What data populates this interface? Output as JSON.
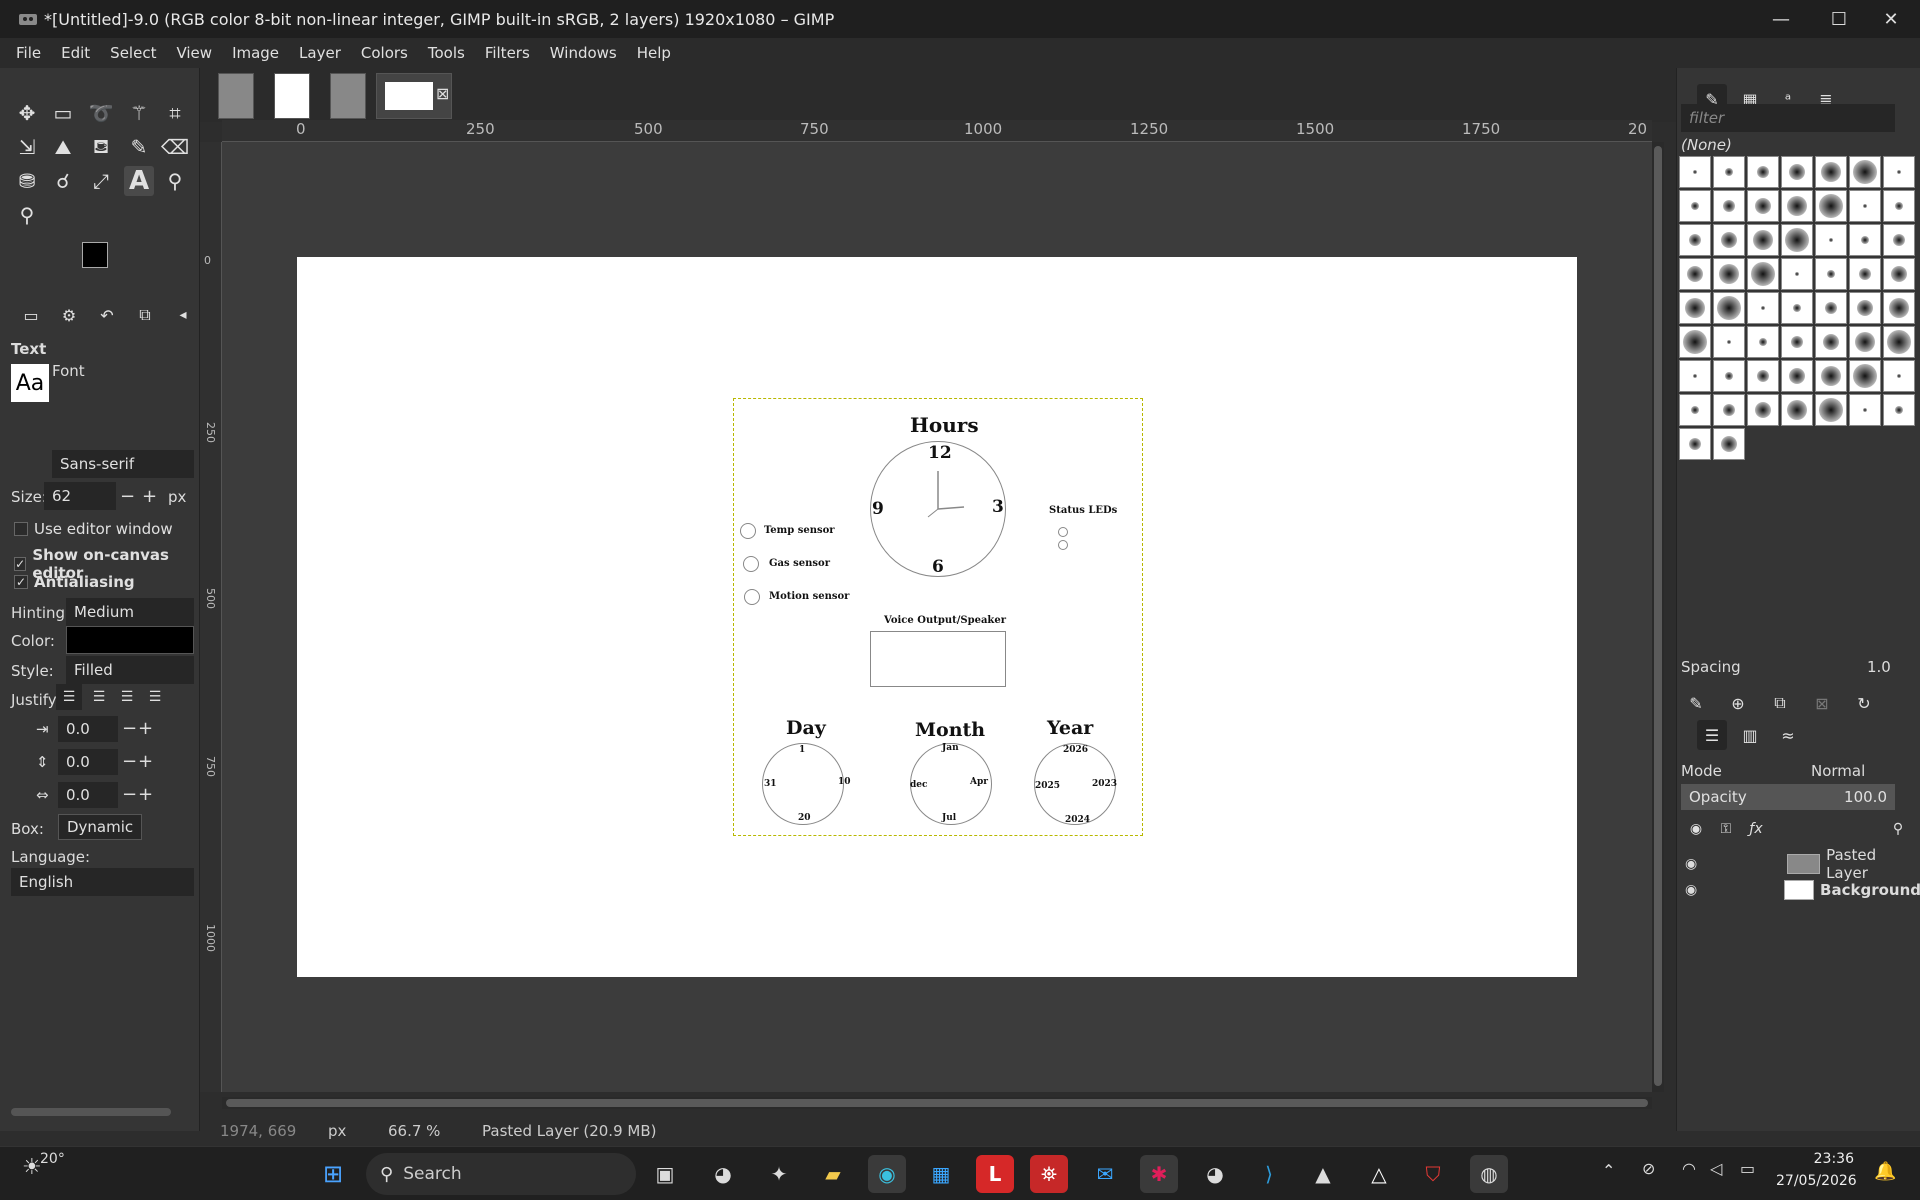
{
  "window": {
    "title": "*[Untitled]-9.0 (RGB color 8-bit non-linear integer, GIMP built-in sRGB, 2 layers) 1920x1080 – GIMP",
    "minimize": "—",
    "maximize": "☐",
    "close": "✕"
  },
  "menu": [
    "File",
    "Edit",
    "Select",
    "View",
    "Image",
    "Layer",
    "Colors",
    "Tools",
    "Filters",
    "Windows",
    "Help"
  ],
  "tool_options": {
    "section_title": "Text",
    "font_label": "Font",
    "font_preview": "Aa",
    "font_value": "Sans-serif",
    "size_label": "Size:",
    "size_value": "62",
    "size_unit": "px",
    "use_editor_window": "Use editor window",
    "show_on_canvas_editor": "Show on-canvas editor",
    "antialiasing": "Antialiasing",
    "hinting_label": "Hinting:",
    "hinting_value": "Medium",
    "color_label": "Color:",
    "style_label": "Style:",
    "style_value": "Filled",
    "justify_label": "Justify:",
    "indent_value": "0.0",
    "line_spacing_value": "0.0",
    "letter_spacing_value": "0.0",
    "box_label": "Box:",
    "box_value": "Dynamic",
    "language_label": "Language:",
    "language_value": "English"
  },
  "ruler": {
    "h_labels": [
      "0",
      "250",
      "500",
      "750",
      "1000",
      "1250",
      "1500",
      "1750",
      "20"
    ],
    "v_labels": [
      "0",
      "250",
      "500",
      "750",
      "1000"
    ]
  },
  "diagram": {
    "hours_title": "Hours",
    "clock_numbers": [
      "12",
      "3",
      "6",
      "9"
    ],
    "sensors": [
      "Temp sensor",
      "Gas sensor",
      "Motion sensor"
    ],
    "status_leds": "Status LEDs",
    "voice_output": "Voice Output/Speaker",
    "day_title": "Day",
    "day_numbers": [
      "1",
      "10",
      "20",
      "31"
    ],
    "month_title": "Month",
    "month_labels": [
      "Jan",
      "Apr",
      "Jul",
      "dec"
    ],
    "year_title": "Year",
    "year_labels": [
      "2026",
      "2023",
      "2024",
      "2025"
    ]
  },
  "statusbar": {
    "coords": "1974, 669",
    "unit": "px",
    "zoom": "66.7 %",
    "info": "Pasted Layer (20.9 MB)"
  },
  "dock": {
    "filter_placeholder": "filter",
    "brush_selected": "(None)",
    "spacing_label": "Spacing",
    "spacing_value": "1.0",
    "mode_label": "Mode",
    "mode_value": "Normal",
    "opacity_label": "Opacity",
    "opacity_value": "100.0",
    "layers": [
      {
        "name": "Pasted Layer"
      },
      {
        "name": "Background"
      }
    ]
  },
  "taskbar": {
    "weather": "20°",
    "search": "Search",
    "time": "23:36",
    "date": "27/05/2026"
  },
  "colors": {
    "accent_blue": "#0078d4",
    "selection_dash": "#b8b800"
  }
}
